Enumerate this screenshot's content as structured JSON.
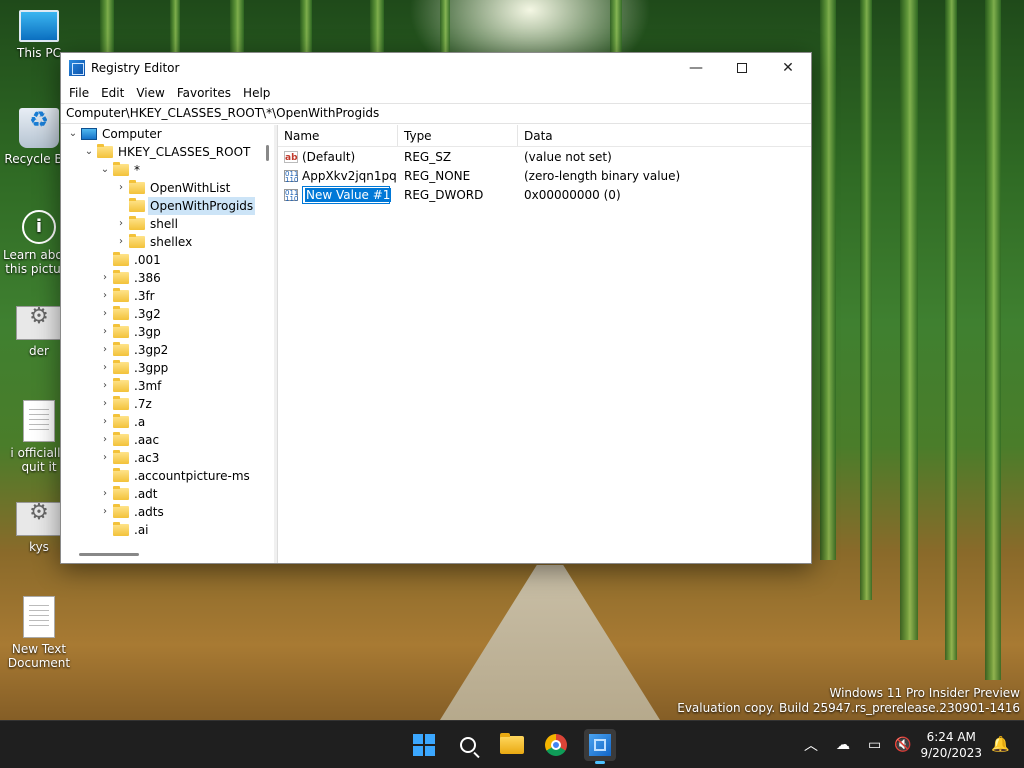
{
  "desktop": {
    "icons": [
      {
        "label": "This PC",
        "icon": "computer-icon"
      },
      {
        "label": "Recycle Bin",
        "icon": "recycle-bin-icon"
      },
      {
        "label": "Learn about this picture",
        "icon": "info-icon"
      },
      {
        "label": "der",
        "icon": "settings-shortcut-icon"
      },
      {
        "label": "i officially quit it",
        "icon": "text-document-icon"
      },
      {
        "label": "kys",
        "icon": "settings-shortcut-icon"
      },
      {
        "label": "New Text Document",
        "icon": "text-document-icon"
      }
    ],
    "watermark": {
      "line1": "Windows 11 Pro Insider Preview",
      "line2": "Evaluation copy. Build 25947.rs_prerelease.230901-1416"
    }
  },
  "window": {
    "title": "Registry Editor",
    "menu": [
      "File",
      "Edit",
      "View",
      "Favorites",
      "Help"
    ],
    "address": "Computer\\HKEY_CLASSES_ROOT\\*\\OpenWithProgids",
    "tree": [
      {
        "label": "Computer",
        "level": 0,
        "type": "computer",
        "expanded": true
      },
      {
        "label": "HKEY_CLASSES_ROOT",
        "level": 1,
        "type": "folder",
        "expanded": true
      },
      {
        "label": "*",
        "level": 2,
        "type": "folder",
        "expanded": true
      },
      {
        "label": "OpenWithList",
        "level": 3,
        "type": "folder",
        "expandable": true
      },
      {
        "label": "OpenWithProgids",
        "level": 3,
        "type": "folder",
        "selected": true
      },
      {
        "label": "shell",
        "level": 3,
        "type": "folder",
        "expandable": true
      },
      {
        "label": "shellex",
        "level": 3,
        "type": "folder",
        "expandable": true
      },
      {
        "label": ".001",
        "level": 2,
        "type": "folder"
      },
      {
        "label": ".386",
        "level": 2,
        "type": "folder",
        "expandable": true
      },
      {
        "label": ".3fr",
        "level": 2,
        "type": "folder",
        "expandable": true
      },
      {
        "label": ".3g2",
        "level": 2,
        "type": "folder",
        "expandable": true
      },
      {
        "label": ".3gp",
        "level": 2,
        "type": "folder",
        "expandable": true
      },
      {
        "label": ".3gp2",
        "level": 2,
        "type": "folder",
        "expandable": true
      },
      {
        "label": ".3gpp",
        "level": 2,
        "type": "folder",
        "expandable": true
      },
      {
        "label": ".3mf",
        "level": 2,
        "type": "folder",
        "expandable": true
      },
      {
        "label": ".7z",
        "level": 2,
        "type": "folder",
        "expandable": true
      },
      {
        "label": ".a",
        "level": 2,
        "type": "folder",
        "expandable": true
      },
      {
        "label": ".aac",
        "level": 2,
        "type": "folder",
        "expandable": true
      },
      {
        "label": ".ac3",
        "level": 2,
        "type": "folder",
        "expandable": true
      },
      {
        "label": ".accountpicture-ms",
        "level": 2,
        "type": "folder"
      },
      {
        "label": ".adt",
        "level": 2,
        "type": "folder",
        "expandable": true
      },
      {
        "label": ".adts",
        "level": 2,
        "type": "folder",
        "expandable": true
      },
      {
        "label": ".ai",
        "level": 2,
        "type": "folder"
      }
    ],
    "columns": {
      "name": "Name",
      "type": "Type",
      "data": "Data"
    },
    "values": [
      {
        "name": "(Default)",
        "type": "REG_SZ",
        "data": "(value not set)",
        "icon": "ab"
      },
      {
        "name": "AppXkv2jqn1pq...",
        "type": "REG_NONE",
        "data": "(zero-length binary value)",
        "icon": "bin"
      },
      {
        "name": "New Value #1",
        "type": "REG_DWORD",
        "data": "0x00000000 (0)",
        "icon": "bin",
        "renaming": true
      }
    ]
  },
  "taskbar": {
    "clock_time": "6:24 AM",
    "clock_date": "9/20/2023"
  }
}
